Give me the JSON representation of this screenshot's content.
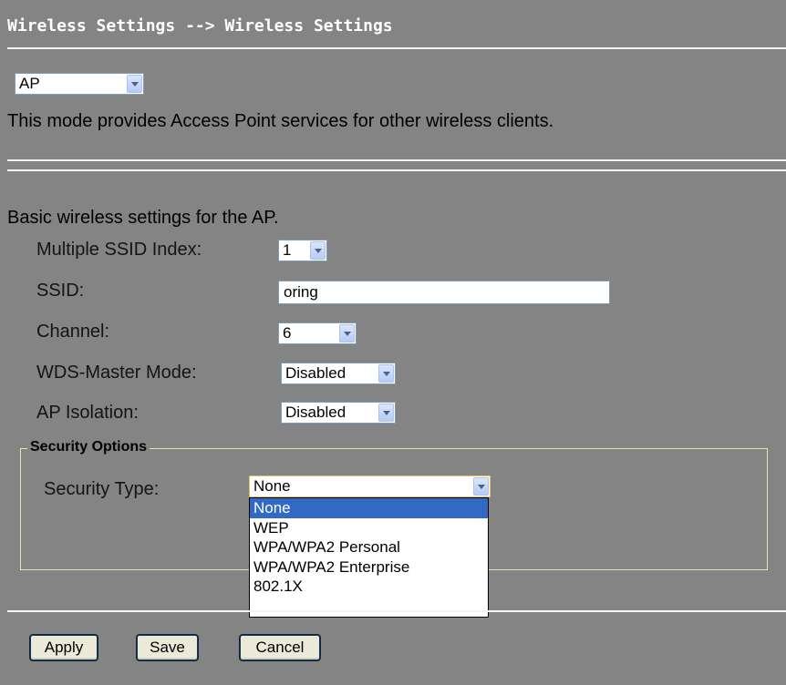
{
  "breadcrumb": "Wireless Settings --> Wireless Settings",
  "mode_select": {
    "value": "AP"
  },
  "mode_description": "This mode provides Access Point services for other wireless clients.",
  "basic_heading": "Basic wireless settings for the AP.",
  "fields": {
    "ssid_index": {
      "label": "Multiple SSID Index:",
      "value": "1"
    },
    "ssid": {
      "label": "SSID:",
      "value": "oring"
    },
    "channel": {
      "label": "Channel:",
      "value": "6"
    },
    "wds_master": {
      "label": "WDS-Master Mode:",
      "value": "Disabled"
    },
    "ap_isolation": {
      "label": "AP Isolation:",
      "value": "Disabled"
    }
  },
  "security": {
    "legend": "Security Options",
    "type_label": "Security Type:",
    "type_value": "None",
    "options": [
      "None",
      "WEP",
      "WPA/WPA2 Personal",
      "WPA/WPA2 Enterprise",
      "802.1X"
    ],
    "highlighted_option": "None"
  },
  "buttons": {
    "apply": "Apply",
    "save": "Save",
    "cancel": "Cancel"
  },
  "colors": {
    "background": "#848484",
    "highlight": "#316ac5",
    "title": "#ffffff"
  }
}
